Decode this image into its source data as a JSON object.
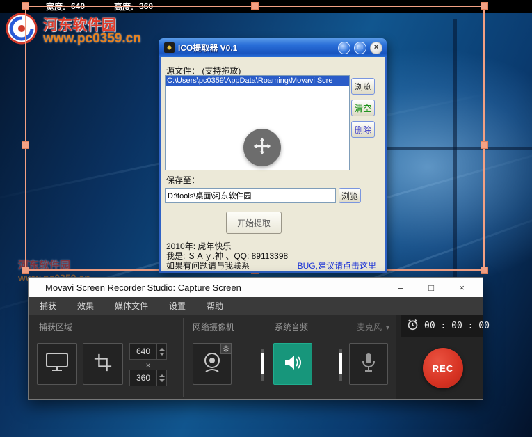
{
  "colors": {
    "selection_orange": "#f2a083",
    "accent_teal": "#17967b",
    "rec_red": "#d63222",
    "highlight_blue": "#2a5cc8",
    "link_blue": "#1a32d8",
    "watermark_red": "#e03a2a",
    "watermark_orange": "#e8821e"
  },
  "dimension_bar": {
    "width_label": "宽度:",
    "width_value": "640",
    "height_label": "高度:",
    "height_value": "360"
  },
  "watermark": {
    "site_name": "河东软件园",
    "site_url": "www.pc0359.cn"
  },
  "ico_dialog": {
    "title": "ICO提取器 V0.1",
    "controls": {
      "minimize": "−",
      "maximize": "□",
      "close": "×"
    },
    "source_label": "源文件： (支持拖放)",
    "file_entry": "C:\\Users\\pc0359\\AppData\\Roaming\\Movavi Scre",
    "browse_button": "浏览",
    "clear_button": "清空",
    "delete_button": "删除",
    "save_label": "保存至：",
    "save_path": "D:\\tools\\桌面\\河东软件园",
    "save_browse_button": "浏览",
    "start_button": "开始提取",
    "footer_line1": "2010年: 虎年快乐",
    "footer_line2": "我是: ＳＡｙ.神 、QQ: 89113398",
    "footer_line3": "如果有问题请与我联系",
    "bug_link": "BUG,建议请点击这里"
  },
  "movavi": {
    "title": "Movavi Screen Recorder Studio: Capture Screen",
    "controls": {
      "minimize": "–",
      "maximize": "□",
      "close": "×"
    },
    "menu": [
      "捕获",
      "效果",
      "媒体文件",
      "设置",
      "帮助"
    ],
    "capture_area": {
      "label": "捕获区域",
      "width": "640",
      "height": "360",
      "separator": "×"
    },
    "webcam": {
      "label": "网络摄像机"
    },
    "system_audio": {
      "label": "系统音频"
    },
    "microphone": {
      "label": "麦克风",
      "chevron": "▾"
    },
    "timer": "00 : 00 : 00",
    "rec_label": "REC"
  }
}
